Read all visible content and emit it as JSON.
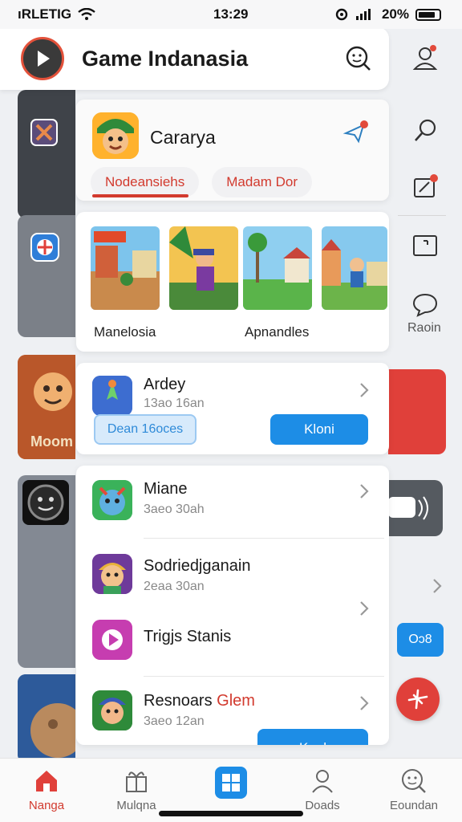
{
  "status_bar": {
    "carrier": "ıRLETIG",
    "time": "13:29",
    "battery": "20%"
  },
  "header": {
    "title": "Game Indanasia"
  },
  "featured": {
    "name": "Cararya",
    "tabs": [
      {
        "label": "Nodeansiehs"
      },
      {
        "label": "Madam Dor"
      }
    ]
  },
  "gallery": {
    "caption_left": "Manelosia",
    "caption_right": "Apnandles"
  },
  "right_rail": {
    "label": "Raoin",
    "badge_button": "Oɔ8"
  },
  "left_col": {
    "card_label": "Moom"
  },
  "list": [
    {
      "title": "Ardey",
      "subtitle": "13ao 16an",
      "btn_left": "Dean 16oces",
      "btn_right": "Kloni"
    },
    {
      "title": "Miane",
      "subtitle": "3aeo 30ah"
    },
    {
      "title": "Sodriedjganain",
      "subtitle": "2eaa 30an"
    },
    {
      "title": "Trigjs Stanis",
      "subtitle": ""
    },
    {
      "title_main": "Resnoars",
      "title_accent": "Glem",
      "subtitle": "3aeo 12an",
      "btn_right": "Kool"
    }
  ],
  "bottom_nav": [
    {
      "label": "Nanga",
      "icon": "home-icon",
      "active": true
    },
    {
      "label": "Mulqna",
      "icon": "gift-icon",
      "active": false
    },
    {
      "label": "",
      "icon": "grid-icon",
      "active": false
    },
    {
      "label": "Doads",
      "icon": "person-icon",
      "active": false
    },
    {
      "label": "Eoundan",
      "icon": "face-search-icon",
      "active": false
    }
  ],
  "colors": {
    "accent_red": "#d23a2e",
    "accent_blue": "#1d8de6"
  }
}
